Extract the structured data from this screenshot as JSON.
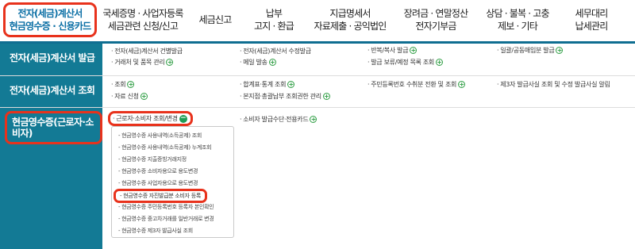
{
  "nav": {
    "items": [
      {
        "line1": "전자(세금)계산서",
        "line2": "현금영수증 · 신용카드"
      },
      {
        "line1": "국세증명 · 사업자등록",
        "line2": "세금관련 신청/신고"
      },
      {
        "line1": "세금신고",
        "line2": ""
      },
      {
        "line1": "납부",
        "line2": "고지 · 환급"
      },
      {
        "line1": "지급명세서",
        "line2": "자료제출 · 공익법인"
      },
      {
        "line1": "장려금 · 연말정산",
        "line2": "전자기부금"
      },
      {
        "line1": "상담 · 불복 · 고충",
        "line2": "제보 · 기타"
      },
      {
        "line1": "세무대리",
        "line2": "납세관리"
      }
    ]
  },
  "rows": {
    "r1": {
      "label": "전자(세금)계산서 발급",
      "items": [
        "전자(세금)계산서 건별발급",
        "전자(세금)계산서 수정발급",
        "반복/복사 발급",
        "일괄/공동매입분 발급",
        "거래처 및 품목 관리",
        "메일 발송",
        "발급 보류/예정 목록 조회"
      ]
    },
    "r2": {
      "label": "전자(세금)계산서 조회",
      "items": [
        "조회",
        "합계표·통계 조회",
        "주민등록번호 수취분 전환 및 조회",
        "제3자 발급사실 조회 및 수정 발급사실 알림",
        "자료 신청",
        "본지점·총괄납부 조회권한 관리"
      ]
    },
    "r3": {
      "label": "현금영수증(근로자·소비자)",
      "items": [
        "근로자·소비자 조회/변경",
        "소비자 발급수단·전용카드"
      ]
    }
  },
  "dropdown": {
    "items": [
      "현금영수증 사용내역(소득공제) 조회",
      "현금영수증 사용내역(소득공제) 누계조회",
      "현금영수증 지출증빙거래지정",
      "현금영수증 소비자용으로 용도변경",
      "현금영수증 사업자용으로 용도변경",
      "현금영수증 자진발급분 소비자 등록",
      "현금영수증 주민등록번호 등록자 본인확인",
      "현금영수증 중고차거래를 일반거래로 변경",
      "현금영수증 제3자 발급사실 조회"
    ]
  },
  "colors": {
    "label_bg": "#137a95",
    "highlight": "#e8321c",
    "plus": "#2f9e44",
    "active_text": "#0b6fa5"
  },
  "icons": {
    "plus": "plus-circle-icon",
    "minus": "minus-circle-icon"
  }
}
